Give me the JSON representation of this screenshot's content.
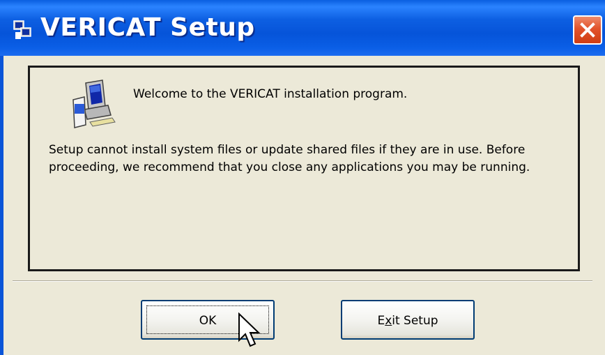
{
  "window": {
    "title": "VERICAT Setup",
    "close_label": "Close"
  },
  "message": {
    "welcome": "Welcome to the VERICAT installation program.",
    "warning": "Setup cannot install system files or update shared files if they are in use. Before proceeding, we recommend that you close any applications you may be running."
  },
  "buttons": {
    "ok_label": "OK",
    "exit_label": "Exit Setup",
    "exit_accelerator": "x"
  },
  "colors": {
    "titlebar": "#0a5ee6",
    "close": "#e2532b",
    "window_bg": "#ece9d8"
  },
  "icons": [
    "setup-installer-icon",
    "computer-setup-icon",
    "close-icon",
    "mouse-pointer-icon"
  ]
}
